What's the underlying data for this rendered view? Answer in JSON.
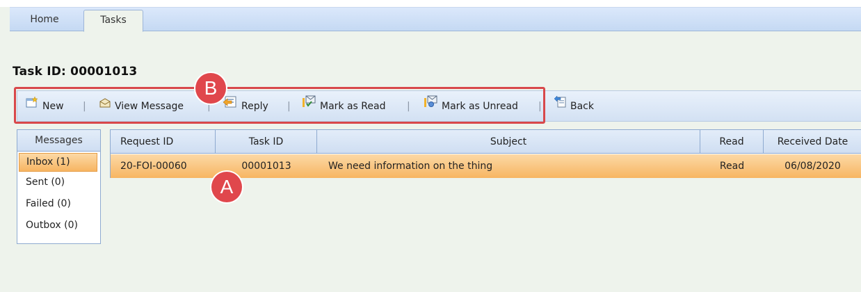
{
  "tabs": [
    {
      "label": "Home"
    },
    {
      "label": "Tasks",
      "active": true
    }
  ],
  "page_title": "Task ID: 00001013",
  "toolbar": {
    "new_label": "New",
    "view_message_label": "View Message",
    "reply_label": "Reply",
    "mark_as_read_label": "Mark as Read",
    "mark_as_unread_label": "Mark as Unread",
    "back_label": "Back",
    "separator": "|"
  },
  "annotations": {
    "a": "A",
    "b": "B",
    "color": "#e0474c"
  },
  "sidebar": {
    "header": "Messages",
    "items": [
      {
        "label": "Inbox (1)",
        "active": true
      },
      {
        "label": "Sent (0)"
      },
      {
        "label": "Failed (0)"
      },
      {
        "label": "Outbox (0)"
      }
    ]
  },
  "grid": {
    "columns": [
      "Request ID",
      "Task ID",
      "Subject",
      "Read",
      "Received Date"
    ],
    "rows": [
      {
        "request_id": "20-FOI-00060",
        "task_id": "00001013",
        "subject": "We need information on the thing",
        "read": "Read",
        "received_date": "06/08/2020"
      }
    ]
  },
  "colors": {
    "accent_selection": "#f7b562",
    "background": "#eef3ec",
    "header_blue": "#cfdef2"
  },
  "icons": [
    "new-icon",
    "view-message-icon",
    "reply-icon",
    "mark-as-read-icon",
    "mark-as-unread-icon",
    "back-icon"
  ]
}
